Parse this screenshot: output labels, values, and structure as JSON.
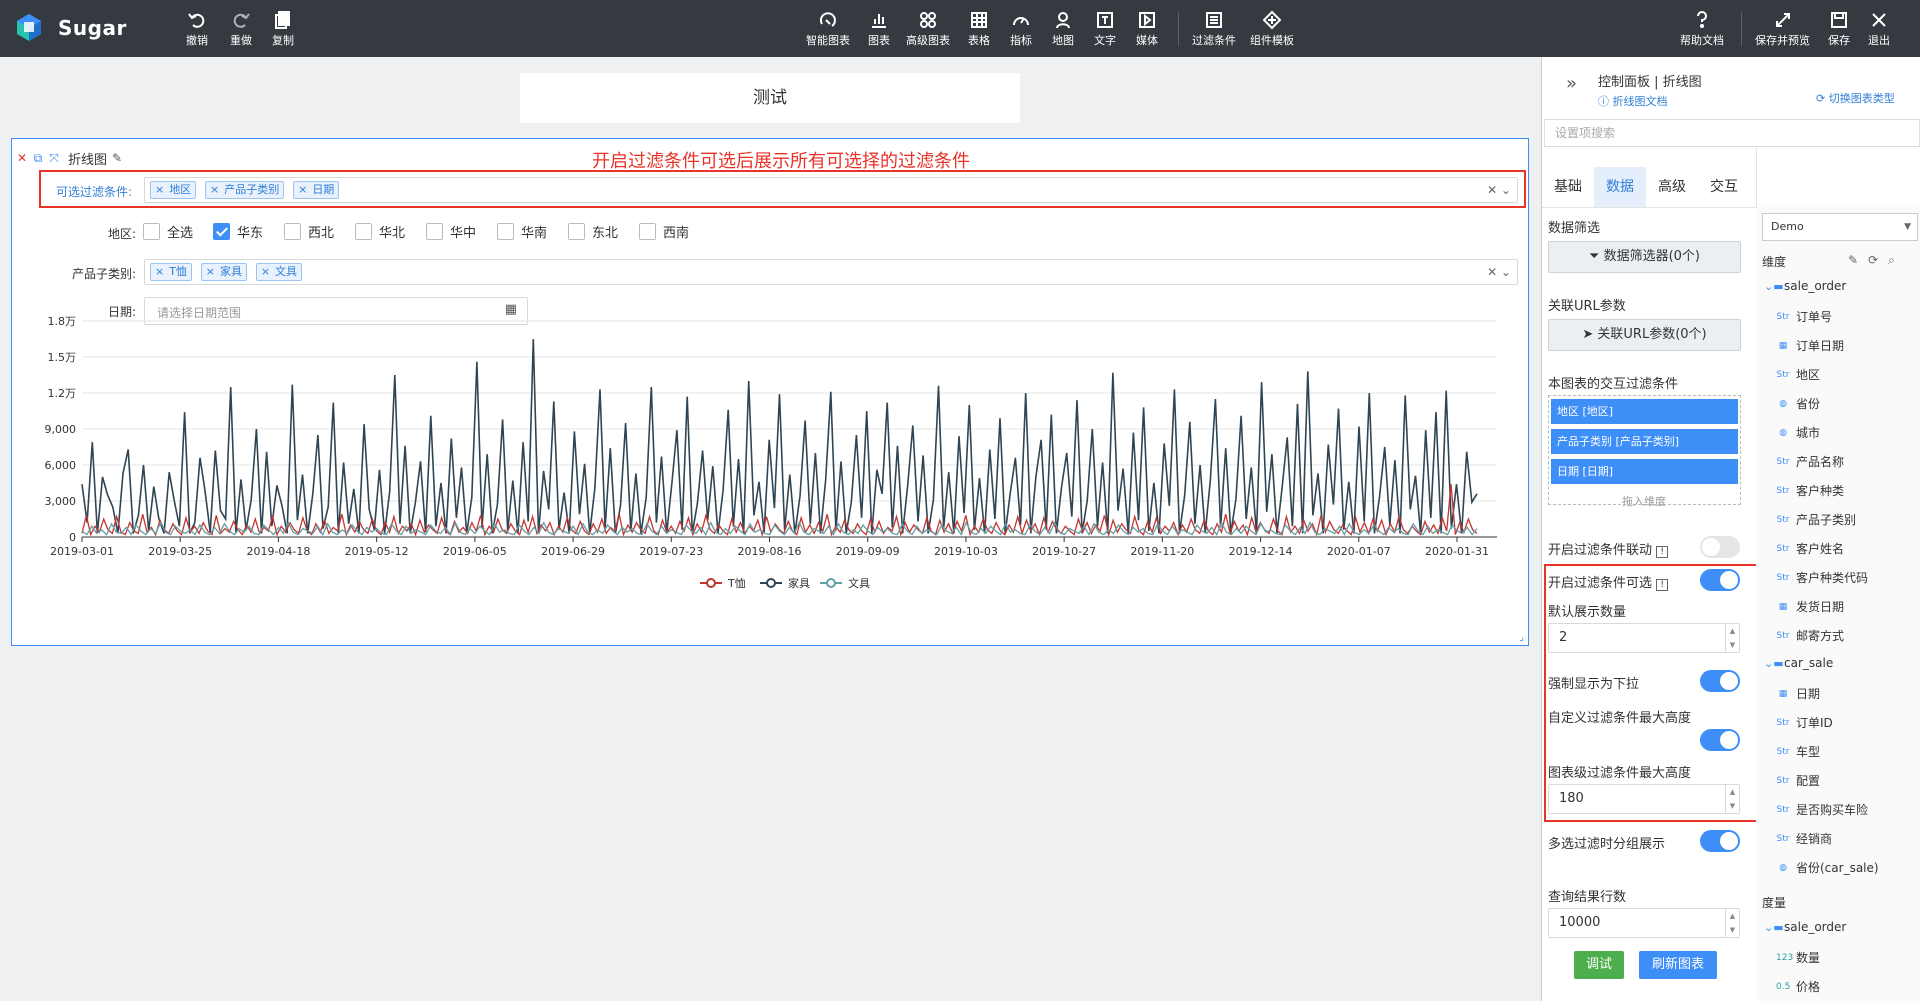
{
  "brand": "Sugar",
  "toolbar_left": [
    {
      "label": "撤销",
      "icon": "undo-icon"
    },
    {
      "label": "重做",
      "icon": "redo-icon"
    },
    {
      "label": "复制",
      "icon": "copy-icon"
    }
  ],
  "toolbar_center": [
    {
      "label": "智能图表"
    },
    {
      "label": "图表"
    },
    {
      "label": "高级图表"
    },
    {
      "label": "表格"
    },
    {
      "label": "指标"
    },
    {
      "label": "地图"
    },
    {
      "label": "文字"
    },
    {
      "label": "媒体"
    },
    {
      "label": "过滤条件"
    },
    {
      "label": "组件模板"
    }
  ],
  "toolbar_right": [
    {
      "label": "帮助文档"
    },
    {
      "label": "保存并预览"
    },
    {
      "label": "保存"
    },
    {
      "label": "退出"
    }
  ],
  "page_title": "测试",
  "card": {
    "title": "折线图",
    "annotation": "开启过滤条件可选后展示所有可选择的过滤条件"
  },
  "filters": {
    "selectable_label": "可选过滤条件:",
    "selectable_tags": [
      "地区",
      "产品子类别",
      "日期"
    ],
    "region_label": "地区:",
    "region_options": [
      {
        "label": "全选",
        "checked": false
      },
      {
        "label": "华东",
        "checked": true
      },
      {
        "label": "西北",
        "checked": false
      },
      {
        "label": "华北",
        "checked": false
      },
      {
        "label": "华中",
        "checked": false
      },
      {
        "label": "华南",
        "checked": false
      },
      {
        "label": "东北",
        "checked": false
      },
      {
        "label": "西南",
        "checked": false
      }
    ],
    "subcat_label": "产品子类别:",
    "subcat_tags": [
      "T恤",
      "家具",
      "文具"
    ],
    "date_label": "日期:",
    "date_placeholder": "请选择日期范围"
  },
  "chart_data": {
    "type": "line",
    "x_ticks": [
      "2019-03-01",
      "2019-03-25",
      "2019-04-18",
      "2019-05-12",
      "2019-06-05",
      "2019-06-29",
      "2019-07-23",
      "2019-08-16",
      "2019-09-09",
      "2019-10-03",
      "2019-10-27",
      "2019-11-20",
      "2019-12-14",
      "2020-01-07",
      "2020-01-31"
    ],
    "y_ticks": [
      "0",
      "3,000",
      "6,000",
      "9,000",
      "1.2万",
      "1.5万",
      "1.8万"
    ],
    "ylim": [
      0,
      18000
    ],
    "series": [
      {
        "name": "T恤",
        "color": "#c23531",
        "values": [
          300,
          1800,
          200,
          900,
          400,
          1500,
          600,
          300,
          1700,
          400,
          200,
          1200,
          500,
          300,
          1900,
          400,
          800,
          200,
          1400,
          600,
          300,
          1100,
          500,
          200,
          1600,
          400,
          900,
          300,
          1200,
          500,
          200,
          1800,
          300,
          700,
          400,
          1300,
          600,
          200,
          1000,
          400,
          1500,
          300,
          800,
          500,
          1700,
          200,
          900,
          400,
          1200,
          600,
          300,
          1600,
          500,
          200,
          1100,
          400,
          1400,
          300,
          800,
          500,
          1900,
          200,
          1000,
          400,
          1300,
          600,
          300,
          1500,
          500,
          200,
          1200,
          400,
          1700,
          300,
          900,
          500,
          1100,
          200,
          1400,
          400,
          1000,
          600,
          300,
          1600,
          500,
          200,
          1300,
          400,
          800,
          300,
          1200,
          500,
          1800,
          200,
          900,
          400,
          1500,
          600,
          300,
          1100,
          500,
          200,
          1400,
          400,
          1700,
          300,
          1000,
          500,
          1200,
          200,
          900,
          400,
          1600,
          600,
          300,
          1300,
          500,
          200,
          1100,
          400,
          1500,
          300,
          800,
          500,
          1900,
          200,
          1000,
          400,
          1200,
          600,
          300,
          1700,
          500,
          200,
          1400,
          400,
          900,
          300,
          1300,
          500,
          1600,
          200,
          1100,
          400,
          1800,
          600,
          300,
          1000,
          500,
          200,
          1500,
          400,
          1200,
          300,
          900,
          500,
          1400,
          200,
          1700,
          400,
          1100,
          600,
          300,
          1300,
          500,
          200,
          1600,
          400,
          1000,
          300,
          1200,
          500,
          1900,
          200,
          900,
          400,
          1400,
          600,
          300,
          1100,
          500,
          200,
          1500,
          400,
          1300,
          300,
          800,
          500,
          1700,
          200,
          1200,
          400,
          1000,
          600,
          300,
          1600,
          500,
          200,
          1400,
          400,
          1100,
          300,
          1300,
          500,
          1800,
          200,
          900,
          400,
          1500,
          600,
          300,
          1200,
          500,
          200,
          1000,
          400,
          1700,
          300,
          1400,
          500,
          1100,
          200,
          1600,
          400,
          1300,
          600,
          300,
          900,
          500,
          200,
          1500,
          400,
          1200,
          300,
          1000,
          500,
          1800,
          200,
          1400,
          400,
          1100,
          600,
          300,
          1700,
          500,
          200,
          1300,
          400,
          1600,
          300,
          900,
          500,
          1200,
          200,
          1000,
          400,
          1500,
          600,
          300,
          1400,
          500,
          200,
          1100,
          400,
          1900,
          300,
          1300,
          500,
          1000,
          200,
          1600,
          400,
          1200,
          600,
          300,
          1500,
          500,
          200,
          1700,
          400,
          900,
          300,
          1400,
          500,
          1100,
          200,
          1800,
          400,
          1300,
          600,
          300,
          1000,
          500,
          200,
          1600,
          400,
          1200,
          300,
          1500,
          500,
          1400,
          200,
          1100,
          400,
          1700,
          600,
          300,
          900,
          500,
          200,
          1300,
          400,
          1000,
          300,
          1600,
          500,
          4400,
          200,
          1200,
          400,
          1500,
          600,
          300
        ]
      },
      {
        "name": "家具",
        "color": "#2f4554",
        "values": [
          4400,
          1200,
          7900,
          300,
          5000,
          3500,
          2500,
          300,
          5300,
          7300,
          300,
          1800,
          6000,
          500,
          4200,
          1500,
          300,
          5400,
          3000,
          900,
          10400,
          300,
          1200,
          6600,
          3800,
          400,
          7200,
          2200,
          1500,
          12500,
          300,
          4800,
          600,
          3100,
          9000,
          300,
          7100,
          900,
          4300,
          2600,
          300,
          12700,
          1400,
          5200,
          300,
          3600,
          8500,
          700,
          2500,
          11200,
          300,
          6200,
          1100,
          4000,
          300,
          9400,
          2300,
          600,
          5600,
          300,
          3800,
          13500,
          1100,
          7600,
          300,
          2900,
          6300,
          400,
          10100,
          900,
          4500,
          300,
          8200,
          1600,
          5800,
          300,
          3300,
          14600,
          800,
          6900,
          300,
          2700,
          9800,
          500,
          4700,
          300,
          7900,
          1300,
          16500,
          300,
          5500,
          2300,
          11300,
          600,
          3700,
          300,
          8800,
          1900,
          6100,
          300,
          4100,
          12300,
          700,
          7400,
          300,
          2600,
          9500,
          500,
          5300,
          300,
          3300,
          12500,
          1200,
          6700,
          300,
          4400,
          8900,
          600,
          11700,
          300,
          2800,
          7200,
          1400,
          5900,
          300,
          3900,
          10600,
          900,
          6500,
          300,
          13000,
          1800,
          4600,
          300,
          8100,
          2400,
          11900,
          600,
          5200,
          300,
          3400,
          9700,
          1100,
          7000,
          300,
          4800,
          12100,
          500,
          6300,
          300,
          2900,
          8500,
          1600,
          10500,
          300,
          5600,
          3600,
          11200,
          800,
          7600,
          300,
          4300,
          9300,
          1300,
          6800,
          300,
          3100,
          12600,
          700,
          5400,
          300,
          8400,
          2000,
          11000,
          600,
          4900,
          300,
          7300,
          1500,
          9900,
          300,
          3700,
          6600,
          1000,
          12000,
          300,
          5000,
          8100,
          600,
          10200,
          300,
          4200,
          7000,
          1700,
          11400,
          300,
          3000,
          9000,
          900,
          6200,
          300,
          13700,
          2200,
          5700,
          300,
          8700,
          1400,
          10800,
          500,
          4500,
          300,
          7800,
          2600,
          12300,
          300,
          3500,
          9600,
          1100,
          6000,
          300,
          4700,
          11500,
          800,
          7400,
          300,
          3200,
          10100,
          1500,
          5800,
          300,
          12900,
          2100,
          6900,
          300,
          4100,
          8300,
          900,
          11100,
          300,
          13800,
          1800,
          5300,
          300,
          7700,
          2700,
          10700,
          600,
          4600,
          300,
          9200,
          1300,
          12000,
          300,
          3400,
          7500,
          1000,
          6400,
          300,
          11800,
          2300,
          5100,
          300,
          8900,
          1600,
          10400,
          300,
          12200,
          700,
          4400,
          300,
          7100,
          2900,
          3600
        ]
      },
      {
        "name": "文具",
        "color": "#61a0a8",
        "values": [
          500,
          200,
          900,
          300,
          600,
          200,
          1100,
          400,
          300,
          800,
          200,
          1000,
          500,
          200,
          700,
          300,
          1200,
          400,
          200,
          900,
          500,
          300,
          600,
          200,
          1000,
          400,
          200,
          800,
          300,
          1100,
          500,
          200,
          700,
          400,
          900,
          300,
          200,
          1000,
          600,
          200,
          800,
          300,
          1200,
          400,
          200,
          700,
          500,
          300,
          900,
          200,
          1100,
          400,
          200,
          600,
          300,
          1000,
          500,
          200,
          800,
          400,
          700,
          300,
          200,
          1100,
          500,
          200,
          900,
          300,
          600,
          400,
          200,
          1000,
          500,
          300,
          800,
          200,
          1200,
          400,
          200,
          700,
          300,
          900,
          500,
          200,
          1100,
          400,
          600,
          300,
          200,
          1000,
          500,
          200,
          800,
          300,
          1200,
          400,
          200,
          700,
          500,
          300,
          900,
          200,
          1100,
          400,
          200,
          600,
          300,
          1000,
          500,
          200,
          800,
          400,
          700,
          300,
          200,
          1100,
          500,
          200,
          900,
          300,
          600,
          400,
          200,
          1000,
          500,
          300,
          800,
          200,
          1200,
          400,
          200,
          700,
          300,
          900,
          500,
          200,
          1100,
          400,
          600,
          300,
          200,
          1000,
          500,
          200,
          800,
          300,
          1200,
          400,
          200,
          700,
          500,
          300,
          900,
          200,
          1100,
          400,
          200,
          600,
          300,
          1000,
          500,
          200,
          800,
          400,
          700,
          300,
          200,
          1100,
          500,
          200,
          900,
          300,
          600,
          400,
          200,
          1000,
          500,
          300,
          800,
          200,
          1200,
          400,
          200,
          700,
          300,
          900,
          500,
          200,
          1100,
          400,
          600,
          300,
          200,
          1000,
          500,
          200,
          800,
          300,
          1200,
          400,
          200,
          700,
          500,
          300,
          900,
          200,
          1100,
          400,
          200,
          600,
          300,
          1000,
          500,
          200,
          800,
          400,
          700,
          300,
          200,
          1100,
          500,
          200,
          900,
          300,
          600,
          400,
          200,
          1000,
          500,
          300,
          800,
          200,
          1200,
          400,
          200,
          700,
          300,
          900,
          500,
          200,
          1100,
          400,
          600,
          300,
          200,
          1000,
          500,
          200,
          800,
          300,
          1200,
          400,
          200,
          700,
          500,
          300,
          900,
          200,
          1100,
          400,
          200,
          600,
          300,
          1000,
          500,
          200,
          800,
          400,
          700,
          300,
          200,
          1100,
          500,
          200,
          900,
          300,
          600,
          400,
          200,
          1000,
          500,
          300,
          800,
          200,
          700
        ]
      }
    ],
    "legend_position": "bottom"
  },
  "panel": {
    "header_title": "控制面板 | 折线图",
    "doc_link": "折线图文档",
    "switch_type": "切换图表类型",
    "search_placeholder": "设置项搜索",
    "tabs": [
      "基础",
      "数据",
      "高级",
      "交互"
    ],
    "active_tab": "数据",
    "data_filter_label": "数据筛选",
    "data_filter_btn": "数据筛选器(0个)",
    "url_param_label": "关联URL参数",
    "url_param_btn": "关联URL参数(0个)",
    "interactive_label": "本图表的交互过滤条件",
    "interactive_items": [
      "地区 [地区]",
      "产品子类别 [产品子类别]",
      "日期 [日期]"
    ],
    "drag_hint": "拖入维度",
    "link_toggle_label": "开启过滤条件联动",
    "selectable_toggle_label": "开启过滤条件可选",
    "default_count_label": "默认展示数量",
    "default_count_value": "2",
    "force_dropdown_label": "强制显示为下拉",
    "custom_max_height_label": "自定义过滤条件最大高度",
    "chart_max_height_label": "图表级过滤条件最大高度",
    "chart_max_height_value": "180",
    "multi_group_label": "多选过滤时分组展示",
    "result_rows_label": "查询结果行数",
    "result_rows_value": "10000",
    "debug_btn": "调试",
    "refresh_btn": "刷新图表",
    "dataset": "Demo",
    "dims_label": "维度",
    "measures_label": "度量",
    "dimensions": [
      {
        "type": "folder",
        "name": "sale_order"
      },
      {
        "type": "Str",
        "name": "订单号"
      },
      {
        "type": "date",
        "name": "订单日期"
      },
      {
        "type": "Str",
        "name": "地区"
      },
      {
        "type": "geo",
        "name": "省份"
      },
      {
        "type": "geo",
        "name": "城市"
      },
      {
        "type": "Str",
        "name": "产品名称"
      },
      {
        "type": "Str",
        "name": "客户种类"
      },
      {
        "type": "Str",
        "name": "产品子类别"
      },
      {
        "type": "Str",
        "name": "客户姓名"
      },
      {
        "type": "Str",
        "name": "客户种类代码"
      },
      {
        "type": "date",
        "name": "发货日期"
      },
      {
        "type": "Str",
        "name": "邮寄方式"
      },
      {
        "type": "folder",
        "name": "car_sale"
      },
      {
        "type": "date",
        "name": "日期"
      },
      {
        "type": "Str",
        "name": "订单ID"
      },
      {
        "type": "Str",
        "name": "车型"
      },
      {
        "type": "Str",
        "name": "配置"
      },
      {
        "type": "Str",
        "name": "是否购买车险"
      },
      {
        "type": "Str",
        "name": "经销商"
      },
      {
        "type": "geo",
        "name": "省份(car_sale)"
      }
    ],
    "measures": [
      {
        "type": "folder",
        "name": "sale_order"
      },
      {
        "type": "123",
        "name": "数量"
      },
      {
        "type": "0.5",
        "name": "价格"
      }
    ]
  }
}
